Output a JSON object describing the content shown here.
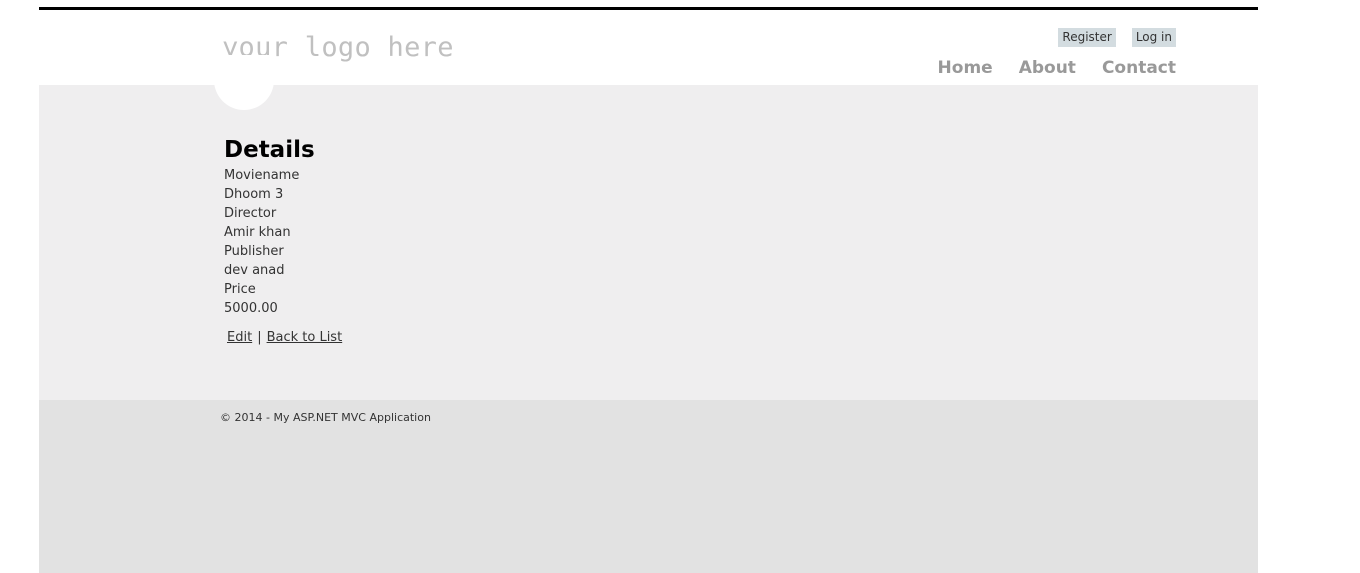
{
  "header": {
    "logo_text": "your logo here",
    "login": {
      "register_label": "Register",
      "login_label": "Log in"
    },
    "menu": {
      "items": [
        {
          "label": "Home"
        },
        {
          "label": "About"
        },
        {
          "label": "Contact"
        }
      ]
    }
  },
  "main": {
    "title": "Details",
    "fields": {
      "moviename_label": "Moviename",
      "moviename_value": "Dhoom 3",
      "director_label": "Director",
      "director_value": "Amir khan",
      "publisher_label": "Publisher",
      "publisher_value": "dev anad",
      "price_label": "Price",
      "price_value": "5000.00"
    },
    "actions": {
      "edit_label": "Edit",
      "separator": "|",
      "back_label": "Back to List"
    }
  },
  "footer": {
    "copyright": "© 2014 - My ASP.NET MVC Application"
  }
}
